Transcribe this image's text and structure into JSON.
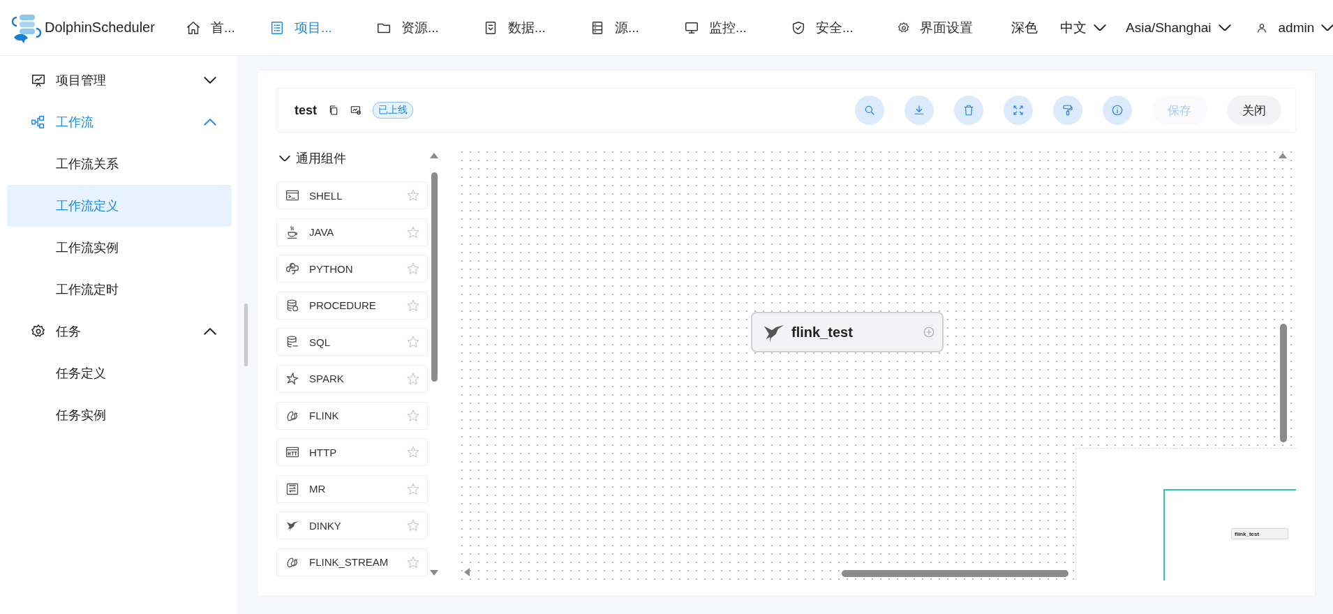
{
  "header": {
    "brand": "DolphinScheduler",
    "nav": [
      {
        "label": "首...",
        "selected": false
      },
      {
        "label": "项目...",
        "selected": true
      },
      {
        "label": "资源...",
        "selected": false
      },
      {
        "label": "数据...",
        "selected": false
      },
      {
        "label": "源...",
        "selected": false
      },
      {
        "label": "监控...",
        "selected": false
      },
      {
        "label": "安全...",
        "selected": false
      },
      {
        "label": "界面设置",
        "selected": false
      }
    ],
    "theme": "深色",
    "language": "中文",
    "timezone": "Asia/Shanghai",
    "user": "admin"
  },
  "sidebar": {
    "items": [
      {
        "label": "项目管理",
        "expanded": false,
        "selected": false
      },
      {
        "label": "工作流",
        "expanded": true,
        "selected": true,
        "children": [
          {
            "label": "工作流关系",
            "selected": false
          },
          {
            "label": "工作流定义",
            "selected": true
          },
          {
            "label": "工作流实例",
            "selected": false
          },
          {
            "label": "工作流定时",
            "selected": false
          }
        ]
      },
      {
        "label": "任务",
        "expanded": true,
        "selected": false,
        "children": [
          {
            "label": "任务定义",
            "selected": false
          },
          {
            "label": "任务实例",
            "selected": false
          }
        ]
      }
    ]
  },
  "toolbar": {
    "title": "test",
    "status": "已上线",
    "buttons": [
      {
        "label": "保存",
        "disabled": true
      },
      {
        "label": "关闭",
        "disabled": false
      }
    ]
  },
  "palette": {
    "title": "通用组件",
    "expanded": true,
    "items": [
      {
        "label": "SHELL",
        "kind": "shell"
      },
      {
        "label": "JAVA",
        "kind": "java"
      },
      {
        "label": "PYTHON",
        "kind": "python"
      },
      {
        "label": "PROCEDURE",
        "kind": "procedure"
      },
      {
        "label": "SQL",
        "kind": "sql"
      },
      {
        "label": "SPARK",
        "kind": "spark"
      },
      {
        "label": "FLINK",
        "kind": "flink"
      },
      {
        "label": "HTTP",
        "kind": "http"
      },
      {
        "label": "MR",
        "kind": "mr"
      },
      {
        "label": "DINKY",
        "kind": "dinky"
      },
      {
        "label": "FLINK_STREAM",
        "kind": "flink"
      }
    ]
  },
  "canvas": {
    "nodes": [
      {
        "label": "flink_test",
        "kind": "dinky"
      }
    ],
    "minimap": {
      "nodes": [
        {
          "label": "flink_test"
        }
      ]
    }
  }
}
